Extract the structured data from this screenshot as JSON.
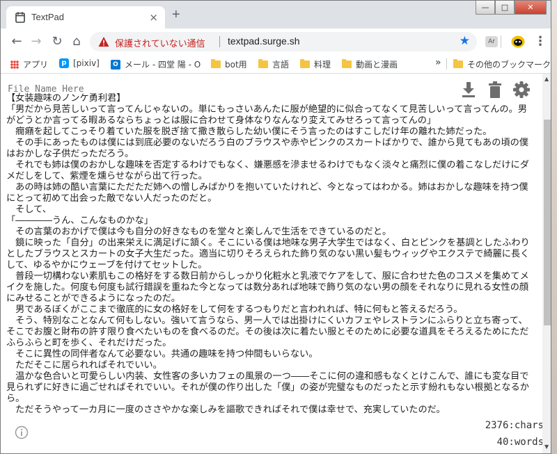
{
  "browser": {
    "tab_title": "TextPad",
    "tab_close": "×",
    "new_tab": "+",
    "window_controls": {
      "minimize": "—",
      "maximize": "□",
      "close": "✕"
    },
    "security_label": "保護されていない通信",
    "url": "textpad.surge.sh",
    "extension_label": "Ar",
    "menu": "⋮"
  },
  "bookmarks": {
    "apps": "アプリ",
    "items": [
      "[pixiv]",
      "メール - 四堂 陽 - O",
      "bot用",
      "言語",
      "料理",
      "動画と漫画"
    ],
    "overflow": "»",
    "other": "その他のブックマーク"
  },
  "editor": {
    "filename_placeholder": "File Name Here",
    "text": "【女装趣味のノンケ勇利君】\n「男だから見苦しいって言ってんじゃないの。単にもっさいあんたに服が絶望的に似合ってなくて見苦しいって言ってんの。男がどうとか言ってる暇あるならちょっとは服に合わせて身体なりなんなり変えてみせろって言ってんの」\n　癇癪を起してこっそり着ていた服を脱ぎ捨て撒き散らした幼い僕にそう言ったのはすこしだけ年の離れた姉だった。\n　その手にあったものは僕には到底必要のないだろう白のブラウスや赤やピンクのスカートばかりで、誰から見てもあの頃の僕はおかしな子供だっただろう。\n　それでも姉は僕のおかしな趣味を否定するわけでもなく、嫌悪感を滲ませるわけでもなく淡々と痛烈に僕の着こなしだけにダメだしをして、紫煙を燻らせながら出て行った。\n　あの時は姉の酷い言葉にただただ姉への憎しみばかりを抱いていたけれど、今となってはわかる。姉はおかしな趣味を持つ僕にとって初めて出会った敵でない人だったのだと。\n　そして、\n「――――うん、こんなものかな」\n　その言葉のおかげで僕は今も自分の好きなものを堂々と楽しんで生活をできているのだと。\n　鏡に映った「自分」の出来栄えに満足げに頷く。そこにいる僕は地味な男子大学生ではなく、白とピンクを基調としたふわりとしたブラウスとスカートの女子大生だった。適当に切りそろえられた飾り気のない黒い髪もウィッグやエクステで綺麗に長くして、ゆるやかにウェーブを付けてセットした。\n　普段一切構わない素肌もこの格好をする数日前からしっかり化粧水と乳液でケアをして、服に合わせた色のコスメを集めてメイクを施した。何度も何度も試行錯誤を重ねた今となっては数分あれば地味で飾り気のない男の顔をそれなりに見れる女性の顔にみせることができるようになったのだ。\n　男であるぼくがここまで徹底的に女の格好をして何をするつもりだと言われれば、特に何もと答えるだろう。\n　そう、特別なことなんて何もしない。強いて言うなら、男一人では出掛けにくいカフェやレストランにふらりと立ち寄って、そこでお腹と財布の許す限り食べたいものを食べるのだ。その後は次に着たい服とそのために必要な道具をそろえるためにただふらふらと町を歩く、それだけだった。\n　そこに異性の同伴者なんて必要ない。共通の趣味を持つ仲間もいらない。\n　ただそこに居られればそれでいい。\n　温かな色合いと可愛らしい内装、女性客の多いカフェの風景の一つ――そこに何の違和感もなくとけこんで、誰にも変な目で見られずに好きに過ごせればそれでいい。それが僕の作り出した「僕」の姿が完璧なものだったと示す紛れもない根拠となるから。\n　ただそうやって一カ月に一度のささやかな楽しみを謳歌できればそれで僕は幸せで、充実していたのだ。",
    "chars": "2376:chars",
    "words": "40:words"
  }
}
